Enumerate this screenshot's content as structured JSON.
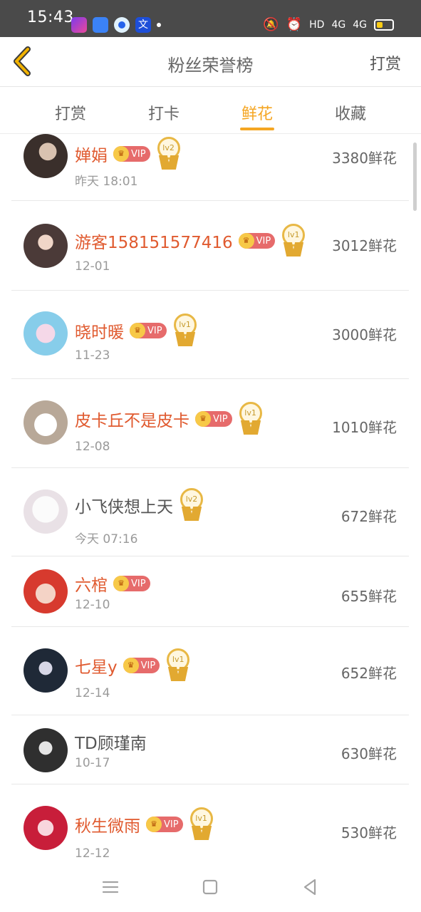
{
  "status_bar": {
    "time": "15:43",
    "right_text": "HD",
    "network_1": "4G",
    "network_2": "4G"
  },
  "header": {
    "title": "粉丝荣誉榜",
    "action_label": "打赏"
  },
  "tabs": [
    {
      "label": "打赏",
      "active": false
    },
    {
      "label": "打卡",
      "active": false
    },
    {
      "label": "鲜花",
      "active": true
    },
    {
      "label": "收藏",
      "active": false
    }
  ],
  "list": [
    {
      "name": "婵娟",
      "vip": true,
      "vip_label": "VIP",
      "level": "lv2",
      "date": "昨天 18:01",
      "amount": "3380鲜花"
    },
    {
      "name": "游客158151577416",
      "vip": true,
      "vip_label": "VIP",
      "level": "lv1",
      "date": "12-01",
      "amount": "3012鲜花"
    },
    {
      "name": "晓时暖",
      "vip": true,
      "vip_label": "VIP",
      "level": "lv1",
      "date": "11-23",
      "amount": "3000鲜花"
    },
    {
      "name": "皮卡丘不是皮卡",
      "vip": true,
      "vip_label": "VIP",
      "level": "lv1",
      "date": "12-08",
      "amount": "1010鲜花"
    },
    {
      "name": "小飞侠想上天",
      "vip": false,
      "level": "lv2",
      "date": "今天 07:16",
      "amount": "672鲜花"
    },
    {
      "name": "六棺",
      "vip": true,
      "vip_label": "VIP",
      "date": "12-10",
      "amount": "655鲜花"
    },
    {
      "name": "七星y",
      "vip": true,
      "vip_label": "VIP",
      "level": "lv1",
      "date": "12-14",
      "amount": "652鲜花"
    },
    {
      "name": "TD顾瑾南",
      "vip": false,
      "date": "10-17",
      "amount": "630鲜花"
    },
    {
      "name": "秋生微雨",
      "vip": true,
      "vip_label": "VIP",
      "level": "lv1",
      "date": "12-12",
      "amount": "530鲜花"
    }
  ],
  "colors": {
    "accent": "#f5a623",
    "vip_name": "#e05a2f",
    "plain_name": "#555555"
  }
}
